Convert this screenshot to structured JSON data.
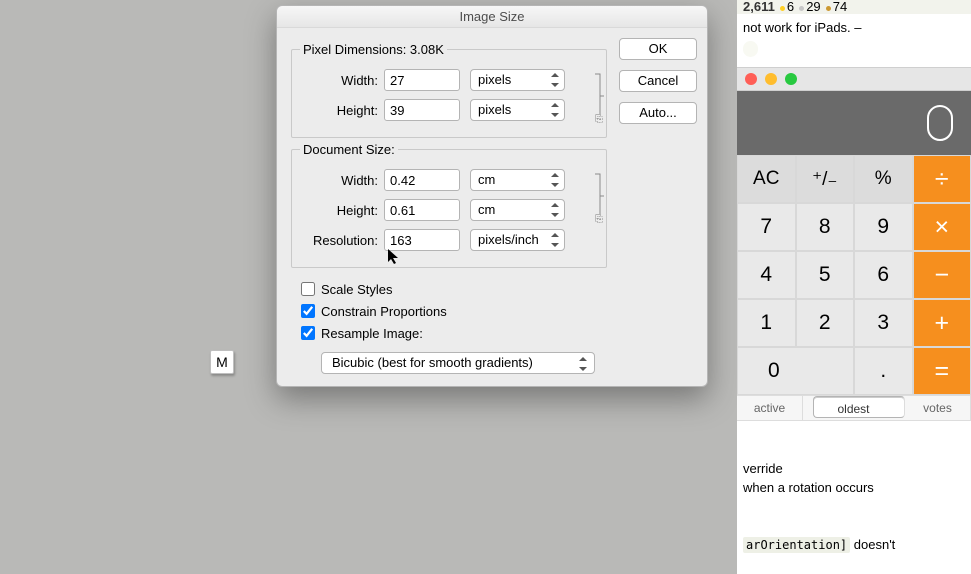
{
  "dialog": {
    "title": "Image Size",
    "pixel_group": {
      "legend": "Pixel Dimensions:  3.08K",
      "width_label": "Width:",
      "width_value": "27",
      "width_unit": "pixels",
      "height_label": "Height:",
      "height_value": "39",
      "height_unit": "pixels"
    },
    "doc_group": {
      "legend": "Document Size:",
      "width_label": "Width:",
      "width_value": "0.42",
      "width_unit": "cm",
      "height_label": "Height:",
      "height_value": "0.61",
      "height_unit": "cm",
      "res_label": "Resolution:",
      "res_value": "163",
      "res_unit": "pixels/inch"
    },
    "scale_styles_label": "Scale Styles",
    "scale_styles_checked": false,
    "constrain_label": "Constrain Proportions",
    "constrain_checked": true,
    "resample_label": "Resample Image:",
    "resample_checked": true,
    "resample_method": "Bicubic (best for smooth gradients)",
    "buttons": {
      "ok": "OK",
      "cancel": "Cancel",
      "auto": "Auto..."
    }
  },
  "m_tile": "M",
  "badges": {
    "rep": "2,611",
    "gold": "6",
    "silver": "29",
    "bronze": "74"
  },
  "note_text": "not work for iPads. –",
  "calc": {
    "ac": "AC",
    "pm": "⁺/₋",
    "pct": "%",
    "div": "÷",
    "k7": "7",
    "k8": "8",
    "k9": "9",
    "mul": "×",
    "k4": "4",
    "k5": "5",
    "k6": "6",
    "min": "−",
    "k1": "1",
    "k2": "2",
    "k3": "3",
    "add": "+",
    "k0": "0",
    "dot": ".",
    "eq": "="
  },
  "tabs": {
    "active": "active",
    "oldest": "oldest",
    "votes": "votes"
  },
  "answer": {
    "line1": "verride",
    "line2": " when a rotation occurs",
    "code": "arOrientation]",
    "after_code": " doesn't"
  }
}
